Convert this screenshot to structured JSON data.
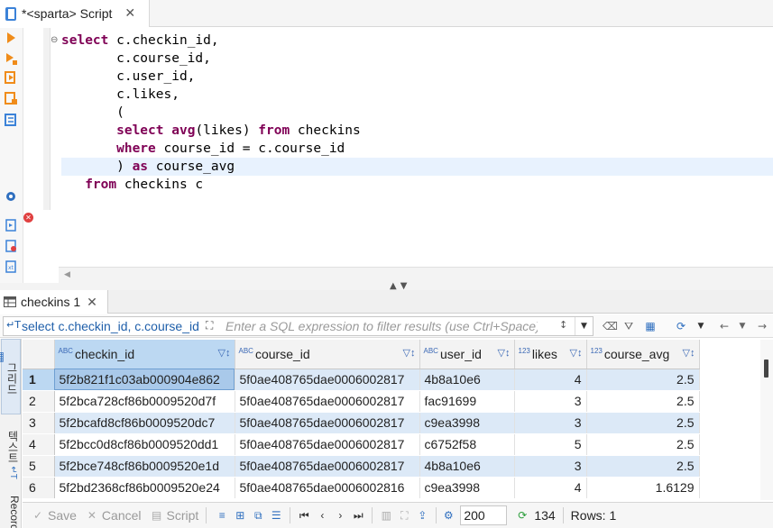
{
  "editor_tab": {
    "title": "*<sparta> Script",
    "close": "✕"
  },
  "code": {
    "lines": [
      [
        {
          "t": "select",
          "k": 1
        },
        {
          "t": " c.checkin_id,"
        }
      ],
      [
        {
          "t": "       c.course_id,"
        }
      ],
      [
        {
          "t": "       c.user_id,"
        }
      ],
      [
        {
          "t": "       c.likes,"
        }
      ],
      [
        {
          "t": "       ("
        }
      ],
      [
        {
          "t": "       "
        },
        {
          "t": "select",
          "k": 1
        },
        {
          "t": " "
        },
        {
          "t": "avg",
          "k": 1
        },
        {
          "t": "(likes) "
        },
        {
          "t": "from",
          "k": 1
        },
        {
          "t": " checkins"
        }
      ],
      [
        {
          "t": "       "
        },
        {
          "t": "where",
          "k": 1
        },
        {
          "t": " course_id = c.course_id"
        }
      ],
      [
        {
          "t": "       ) "
        },
        {
          "t": "as",
          "k": 1
        },
        {
          "t": " course_avg"
        }
      ],
      [
        {
          "t": "   "
        },
        {
          "t": "from",
          "k": 1
        },
        {
          "t": " checkins c"
        }
      ]
    ]
  },
  "results_tab": {
    "title": "checkins 1",
    "close": "✕"
  },
  "filter": {
    "query": "select c.checkin_id, c.course_id",
    "placeholder": "Enter a SQL expression to filter results (use Ctrl+Space)"
  },
  "side_tabs": {
    "grid": "그리드",
    "text": "텍스트",
    "record": "Record"
  },
  "grid": {
    "columns": [
      {
        "name": "checkin_id",
        "type": "ABC"
      },
      {
        "name": "course_id",
        "type": "ABC"
      },
      {
        "name": "user_id",
        "type": "ABC"
      },
      {
        "name": "likes",
        "type": "123"
      },
      {
        "name": "course_avg",
        "type": "123"
      }
    ],
    "rows": [
      [
        "1",
        "5f2b821f1c03ab000904e862",
        "5f0ae408765dae0006002817",
        "4b8a10e6",
        "4",
        "2.5"
      ],
      [
        "2",
        "5f2bca728cf86b0009520d7f",
        "5f0ae408765dae0006002817",
        "fac91699",
        "3",
        "2.5"
      ],
      [
        "3",
        "5f2bcafd8cf86b0009520dc7",
        "5f0ae408765dae0006002817",
        "c9ea3998",
        "3",
        "2.5"
      ],
      [
        "4",
        "5f2bcc0d8cf86b0009520dd1",
        "5f0ae408765dae0006002817",
        "c6752f58",
        "5",
        "2.5"
      ],
      [
        "5",
        "5f2bce748cf86b0009520e1d",
        "5f0ae408765dae0006002817",
        "4b8a10e6",
        "3",
        "2.5"
      ],
      [
        "6",
        "5f2bd2368cf86b0009520e24",
        "5f0ae408765dae0006002816",
        "c9ea3998",
        "4",
        "1.6129"
      ]
    ]
  },
  "bottombar": {
    "save": "Save",
    "cancel": "Cancel",
    "script": "Script",
    "fetch_size": "200",
    "fetch_count": "134",
    "rows": "Rows: 1"
  },
  "colors": {
    "keyword": "#7f0055",
    "selection": "#bcd8f2",
    "stripe": "#dce9f7",
    "accent": "#2f6fbf"
  }
}
